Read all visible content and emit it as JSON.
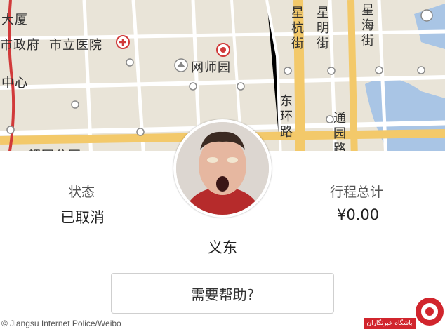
{
  "map": {
    "labels": {
      "dasha": "大厦",
      "zhengfu": "市政府",
      "hospital": "市立医院",
      "wangshiyuan": "网师园",
      "zhongxin": "中心",
      "xinghang": "星杭街",
      "xingming": "星明街",
      "xinghai": "星海街",
      "donghuan": "东环路",
      "tongyuan": "通园路",
      "gongyuan": "耦园公园"
    },
    "colors": {
      "background": "#e9e4d8",
      "main_road": "#f3c96a",
      "road": "#ffffff",
      "water": "#a9c5e5",
      "rail": "#d13a3a"
    }
  },
  "trip": {
    "status_label": "状态",
    "status_value": "已取消",
    "total_label": "行程总计",
    "total_value": "¥0.00",
    "driver_name": "义东",
    "help_label": "需要帮助?"
  },
  "credit": "© Jiangsu Internet Police/Weibo",
  "watermark": {
    "text": "باشگاه خبرنگاران"
  }
}
